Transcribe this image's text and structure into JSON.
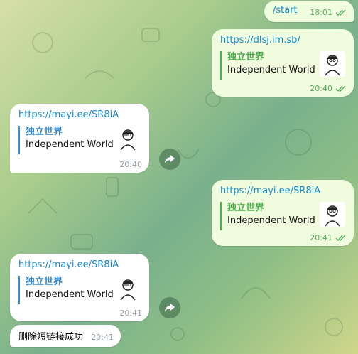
{
  "messages": [
    {
      "type": "command",
      "text": "/start",
      "time": "18:01"
    },
    {
      "link": "https://dlsj.im.sb/",
      "preview_title": "独立世界",
      "preview_desc": "Independent World",
      "time": "20:40"
    },
    {
      "link": "https://mayi.ee/SR8iA",
      "preview_title": "独立世界",
      "preview_desc": "Independent World",
      "time": "20:40"
    },
    {
      "link": "https://mayi.ee/SR8iA",
      "preview_title": "独立世界",
      "preview_desc": "Independent World",
      "time": "20:41"
    },
    {
      "link": "https://mayi.ee/SR8iA",
      "preview_title": "独立世界",
      "preview_desc": "Independent World",
      "time": "20:41"
    },
    {
      "type": "text",
      "text": "删除短链接成功",
      "time": "20:41"
    }
  ],
  "icons": {
    "read_check": "double-check-icon",
    "share": "share-arrow-icon",
    "thumbnail": "avatar-thumbnail"
  },
  "colors": {
    "outgoing_bubble": "#effdde",
    "incoming_bubble": "#ffffff",
    "link": "#168acd",
    "outgoing_accent": "#4fae4e",
    "incoming_accent": "#2f83c6"
  }
}
